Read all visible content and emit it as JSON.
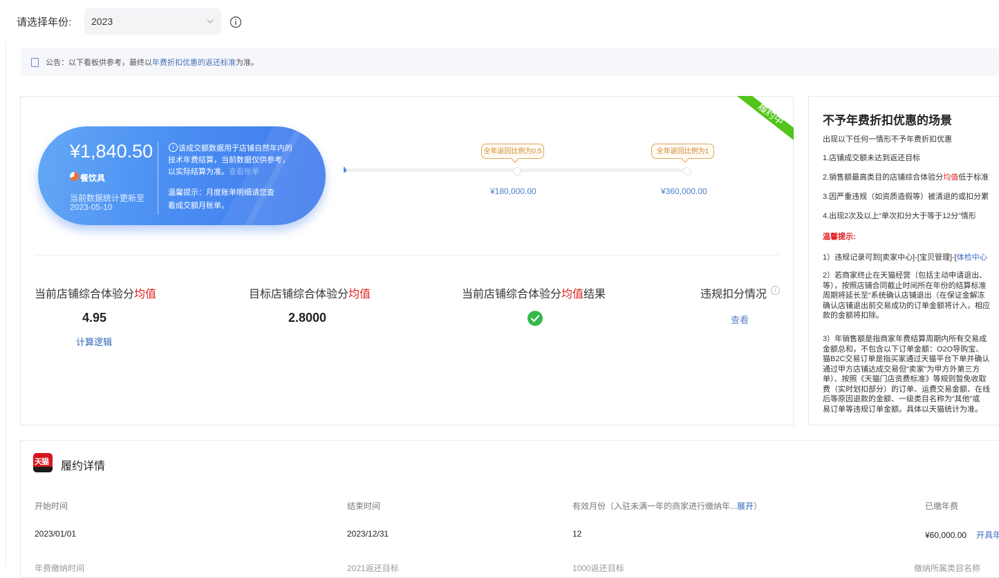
{
  "year_selector": {
    "label": "请选择年份:",
    "value": "2023"
  },
  "notice": {
    "prefix": "公告：以下看板供参考，最终以",
    "link": "年费折扣优惠的返还标准",
    "suffix": "为准。"
  },
  "badge": {
    "status": "履约中"
  },
  "summary": {
    "amount": "¥1,840.50",
    "category": "餐饮具",
    "update_line1": "当前数据统计更新至",
    "update_line2": "2023-05-10",
    "note_line1": "该成交额数据用于店铺自然年内的",
    "note_line2": "技术年费结算，当前数据仅供参考，",
    "note_line3": "以实际结算为准。",
    "note_link": "查看账单",
    "tip_line1": "温馨提示：月度账单明细请您查",
    "tip_line2": "看成交额月账单。"
  },
  "progress": {
    "fraction": 0.0051,
    "milestones": [
      {
        "label": "全年返回比例为0.5",
        "amount": "¥180,000.00"
      },
      {
        "label": "全年返回比例为1",
        "amount": "¥360,000.00"
      }
    ]
  },
  "stats": [
    {
      "title_pre": "当前店铺综合体验分",
      "title_red": "均值",
      "title_post": "",
      "value": "4.95",
      "link": "计算逻辑"
    },
    {
      "title_pre": "目标店铺综合体验分",
      "title_red": "均值",
      "title_post": "",
      "value": "2.8000"
    },
    {
      "title_pre": "当前店铺综合体验分",
      "title_red": "均值",
      "title_post": "结果",
      "result": "check"
    },
    {
      "title_pre": "违规扣分情况",
      "title_red": "",
      "title_post": "",
      "link": "查看"
    }
  ],
  "rules_panel": {
    "title": "不予年费折扣优惠的场景",
    "intro": "出现以下任何一情形不予年费折扣优惠",
    "items": [
      {
        "pre": "1.店铺成交额未达到返还目标",
        "red": "",
        "post": ""
      },
      {
        "pre": "2.销售额最高类目的店铺综合体验分",
        "red": "均值",
        "post": "低于标准"
      },
      {
        "pre": "3.因严重违规（如资质造假等）被清退的或扣分累",
        "red": "",
        "post": ""
      },
      {
        "pre": "4.出现2次及以上“单次扣分大于等于12分”情形",
        "red": "",
        "post": ""
      }
    ],
    "tip_title": "温馨提示:",
    "tip1_pre": "1）违规记录可到[卖家中心]-[宝贝管理]-[",
    "tip1_link": "体检中心",
    "tip2_lines": [
      "2）若商家终止在天猫经营（包括主动申请退出、",
      "等），按照店铺合同截止时间所在年份的结算标准",
      "周期将延长至“系统确认店铺退出（在保证金解冻",
      "确认店铺退出前交易成功的订单金额将计入，相应",
      "款的金额将扣除。"
    ],
    "tip3_lines": [
      "3）年销售额是指商家年费结算周期内所有交易成",
      "金额总和，不包含以下订单金额：O2O导购宝、",
      "猫B2C交易订单是指买家通过天猫平台下单并确认",
      "通过甲方店铺达成交易但“卖家”为甲方外第三方",
      "单）、按照《天猫门店资费标准》等规则暂免收取",
      "费（实时划扣部分）的订单、运费交易金额、在线",
      "后等原因退款的金额、一级类目名称为“其他”或",
      "易订单等违规订单金额。具体以天猫统计为准。"
    ]
  },
  "contract": {
    "title": "履约详情",
    "columns": [
      {
        "header": "开始时间",
        "value": "2023/01/01"
      },
      {
        "header": "结束时间",
        "value": "2023/12/31"
      },
      {
        "header_pre": "有效月份（入驻未满一年的商家进行缴纳年...",
        "header_link": "展开",
        "header_post": "）",
        "value": "12"
      },
      {
        "header": "已缴年费",
        "value": "¥60,000.00",
        "value_link": "开具年"
      }
    ],
    "next_row": [
      "年费缴纳时间",
      "2021返还目标",
      "1000返还目标",
      "缴纳所属类目名称"
    ]
  },
  "colors": {
    "accent_blue": "#3f78ec",
    "warning_red": "#e02020",
    "success_green": "#35b84c",
    "ribbon_green": "#52c41a",
    "milestone_orange": "#d08a35"
  }
}
